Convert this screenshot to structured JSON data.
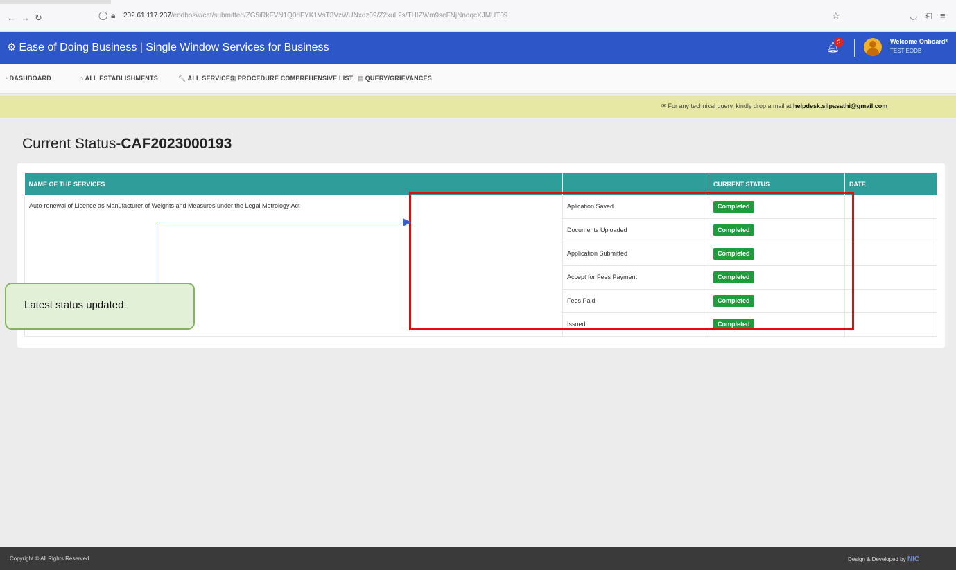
{
  "browser": {
    "url_host": "202.61.117.237",
    "url_path": "/eodbosw/caf/submitted/ZG5iRkFVN1Q0dFYK1VsT3VzWUNxdz09/Z2xuL2s/THIZWm9seFNjNndqcXJMUT09",
    "icons": [
      "back-arrow-icon",
      "forward-arrow-icon",
      "reload-icon",
      "shield-icon",
      "lock-icon",
      "star-icon",
      "pocket-icon",
      "extensions-icon",
      "menu-icon"
    ]
  },
  "header": {
    "logo_icon": "cogs-icon",
    "title": "Ease of Doing Business | Single Window Services for Business",
    "notification_count": "3",
    "welcome": "Welcome Onboard*",
    "user": "TEST EODB",
    "bg_color": "#2d56c9"
  },
  "menu": {
    "items": [
      {
        "label": "DASHBOARD",
        "icon": "dashboard-icon"
      },
      {
        "label": "ALL ESTABLISHMENTS",
        "icon": "building-icon"
      },
      {
        "label": "ALL SERVICES",
        "icon": "wrench-icon"
      },
      {
        "label": "PROCEDURE COMPREHENSIVE LIST",
        "icon": "list-icon"
      },
      {
        "label": "QUERY/GRIEVANCES",
        "icon": "list-icon"
      }
    ]
  },
  "notice": {
    "text": "For any technical query, kindly drop a mail at ",
    "email": "helpdesk.silpasathi@gmail.com",
    "bg_color": "#e6e8a3"
  },
  "page": {
    "title_prefix": "Current Status-",
    "title_id": "CAF2023000193"
  },
  "table": {
    "headers": [
      "NAME OF THE SERVICES",
      "",
      "CURRENT STATUS",
      "DATE"
    ],
    "service_name": "Auto-renewal of Licence as Manufacturer of Weights and Measures under the Legal Metrology Act",
    "rows": [
      {
        "stage": "Aplication Saved",
        "status": "Completed",
        "date": ""
      },
      {
        "stage": "Documents Uploaded",
        "status": "Completed",
        "date": ""
      },
      {
        "stage": "Application Submitted",
        "status": "Completed",
        "date": ""
      },
      {
        "stage": "Accept for Fees Payment",
        "status": "Completed",
        "date": ""
      },
      {
        "stage": "Fees Paid",
        "status": "Completed",
        "date": ""
      },
      {
        "stage": "Issued",
        "status": "Completed",
        "date": ""
      }
    ],
    "header_color": "#2f9d99",
    "status_color": "#1f9d3c"
  },
  "annotation": {
    "callout_text": "Latest status updated.",
    "highlight_color": "#e20d0d"
  },
  "footer": {
    "copyright": "Copyright © All Rights Reserved",
    "design": "Design & Developed by",
    "design_brand": "NIC"
  }
}
